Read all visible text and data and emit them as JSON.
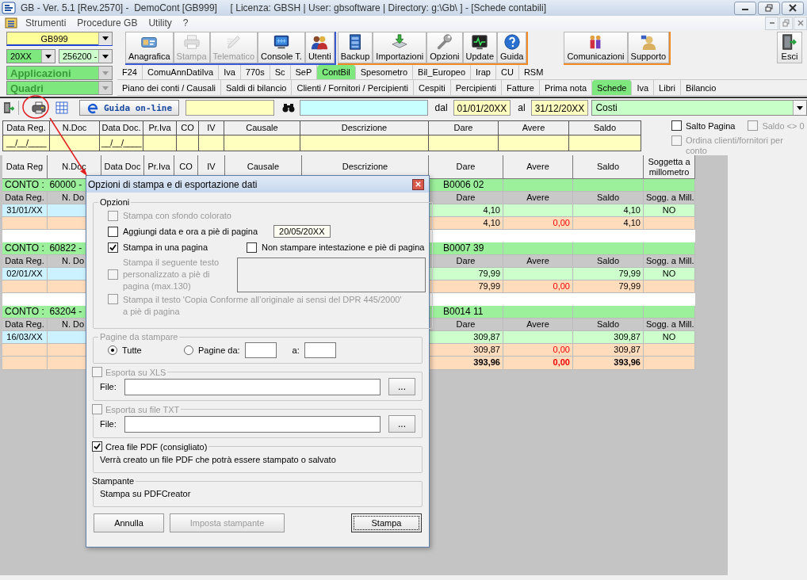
{
  "window": {
    "title": "GB - Ver. 5.1 [Rev.2570] -  DemoCont [GB999]     [ Licenza: GBSH | User: gbsoftware | Directory: g:\\Gb\\ ] - [Schede contabili]"
  },
  "menu": [
    "Strumenti",
    "Procedure GB",
    "Utility",
    "?"
  ],
  "selectors": {
    "company": "GB999",
    "year": "20XX",
    "account": "256200 -",
    "applications": "Applicazioni",
    "sections": "Quadri"
  },
  "toolbar_groups": [
    {
      "color": "#3a5bd0",
      "buttons": [
        {
          "label": "Anagrafica",
          "disabled": false
        },
        {
          "label": "Stampa",
          "disabled": true
        },
        {
          "label": "Telematico",
          "disabled": true
        },
        {
          "label": "Console T.",
          "disabled": false
        },
        {
          "label": "Utenti",
          "disabled": false
        }
      ]
    },
    {
      "color": "#f08a24",
      "buttons": [
        {
          "label": "Backup",
          "disabled": false
        },
        {
          "label": "Importazioni",
          "disabled": false
        },
        {
          "label": "Opzioni",
          "disabled": false
        },
        {
          "label": "Update",
          "disabled": false
        },
        {
          "label": "Guida",
          "disabled": false
        }
      ]
    },
    {
      "color": "#f08a24",
      "buttons": [
        {
          "label": "Comunicazioni",
          "disabled": false
        },
        {
          "label": "Supporto",
          "disabled": false
        }
      ]
    },
    {
      "buttons": [
        {
          "label": "Esci",
          "disabled": false
        }
      ]
    }
  ],
  "app_tabs": [
    {
      "label": "F24",
      "selected": false
    },
    {
      "label": "ComuAnnDatiIva",
      "selected": false
    },
    {
      "label": "Iva",
      "selected": false
    },
    {
      "label": "770s",
      "selected": false
    },
    {
      "label": "Sc",
      "selected": false
    },
    {
      "label": "SeP",
      "selected": false
    },
    {
      "label": "ContBil",
      "selected": true
    },
    {
      "label": "Spesometro",
      "selected": false
    },
    {
      "label": "Bil_Europeo",
      "selected": false
    },
    {
      "label": "Irap",
      "selected": false
    },
    {
      "label": "CU",
      "selected": false
    },
    {
      "label": "RSM",
      "selected": false
    }
  ],
  "section_tabs": [
    {
      "label": "Piano dei conti / Causali",
      "selected": false
    },
    {
      "label": "Saldi di bilancio",
      "selected": false
    },
    {
      "label": "Clienti / Fornitori / Percipienti",
      "selected": false
    },
    {
      "label": "Cespiti",
      "selected": false
    },
    {
      "label": "Percipienti",
      "selected": false
    },
    {
      "label": "Fatture",
      "selected": false
    },
    {
      "label": "Prima nota",
      "selected": false
    },
    {
      "label": "Schede",
      "selected": true
    },
    {
      "label": "Iva",
      "selected": false
    },
    {
      "label": "Libri",
      "selected": false
    },
    {
      "label": "Bilancio",
      "selected": false
    }
  ],
  "filter_bar": {
    "help_button": "Guida on-line",
    "date_from_label": "dal",
    "date_from": "01/01/20XX",
    "date_to_label": "al",
    "date_to": "31/12/20XX",
    "category": "Costi"
  },
  "filter_grid": [
    {
      "label": "Data Reg.",
      "mask": "__/__/____"
    },
    {
      "label": "N.Doc"
    },
    {
      "label": "Data Doc.",
      "mask": "__/__/____"
    },
    {
      "label": "Pr.Iva"
    },
    {
      "label": "CO"
    },
    {
      "label": "IV"
    },
    {
      "label": "Causale"
    },
    {
      "label": "Descrizione"
    },
    {
      "label": "Dare"
    },
    {
      "label": "Avere"
    },
    {
      "label": "Saldo"
    }
  ],
  "filter_options": [
    {
      "label": "Salto Pagina",
      "checked": false,
      "disabled": false
    },
    {
      "label": "Saldo <> 0",
      "checked": false,
      "disabled": true
    },
    {
      "label": "Ordina clienti/fornitori per conto",
      "checked": false,
      "disabled": true
    }
  ],
  "table": {
    "columns": [
      "Data Reg",
      "N.Doc",
      "Data Doc",
      "Pr.Iva",
      "CO",
      "IV",
      "Causale",
      "Descrizione",
      "Dare",
      "Avere",
      "Saldo",
      "Soggetta a millometro"
    ],
    "groups": [
      {
        "conto": "CONTO :  60000 -",
        "code": "B0006 02",
        "headers_left": [
          "Data Reg.",
          "N. Do"
        ],
        "headers_right": [
          "Dare",
          "Avere",
          "Saldo",
          "Sogg. a Mill."
        ],
        "entry": {
          "date": "31/01/XX",
          "dare": "4,10",
          "saldo": "4,10",
          "mill": "NO"
        },
        "total": {
          "dare": "4,10",
          "avere": "0,00",
          "saldo": "4,10"
        }
      },
      {
        "conto": "CONTO :  60822 -",
        "code": "B0007 39",
        "headers_left": [
          "Data Reg.",
          "N. Do"
        ],
        "headers_right": [
          "Dare",
          "Avere",
          "Saldo",
          "Sogg. a Mill."
        ],
        "entry": {
          "date": "02/01/XX",
          "dare": "79,99",
          "saldo": "79,99",
          "mill": "NO"
        },
        "total": {
          "dare": "79,99",
          "avere": "0,00",
          "saldo": "79,99"
        }
      },
      {
        "conto": "CONTO :  63204 -",
        "code": "B0014 11",
        "headers_left": [
          "Data Reg.",
          "N. Do"
        ],
        "headers_right": [
          "Dare",
          "Avere",
          "Saldo",
          "Sogg. a Mill."
        ],
        "entry": {
          "date": "16/03/XX",
          "dare": "309,87",
          "saldo": "309,87",
          "mill": "NO"
        },
        "total": {
          "dare": "309,87",
          "avere": "0,00",
          "saldo": "309,87"
        }
      }
    ],
    "grand_total": {
      "dare": "393,96",
      "avere": "0,00",
      "saldo": "393,96"
    }
  },
  "dialog": {
    "title": "Opzioni di stampa e di esportazione dati",
    "options_legend": "Opzioni",
    "options": [
      {
        "label": "Stampa con sfondo colorato",
        "checked": false,
        "disabled": true
      },
      {
        "label": "Aggiungi data e ora a piè di pagina",
        "checked": false,
        "disabled": false,
        "value": "20/05/20XX"
      },
      {
        "label": "Stampa in una pagina",
        "checked": true,
        "disabled": false
      },
      {
        "label": "Non stampare intestazione e piè di pagina",
        "checked": false,
        "disabled": false
      },
      {
        "label": "Stampa il seguente testo personalizzato a piè di pagina (max.130)",
        "checked": false,
        "disabled": true
      },
      {
        "label": "Stampa il testo 'Copia Conforme all’originale ai sensi del DPR 445/2000' a piè di pagina",
        "checked": false,
        "disabled": true
      }
    ],
    "pages": {
      "legend": "Pagine da stampare",
      "disabled": true,
      "choices": [
        {
          "label": "Tutte",
          "selected": true
        },
        {
          "label": "Pagine da:",
          "selected": false
        }
      ],
      "to_label": "a:"
    },
    "exports": [
      {
        "label": "Esporta su XLS",
        "checked": false,
        "disabled": true,
        "file_label": "File:",
        "browse": "..."
      },
      {
        "label": "Esporta su file TXT",
        "checked": false,
        "disabled": true,
        "file_label": "File:",
        "browse": "..."
      }
    ],
    "pdf": {
      "label": "Crea file PDF (consigliato)",
      "checked": true,
      "note": "Verrà creato un file PDF che potrà essere stampato o salvato"
    },
    "printer": {
      "legend": "Stampante",
      "name": "Stampa su PDFCreator"
    },
    "buttons": [
      {
        "label": "Annulla",
        "disabled": false,
        "default": false
      },
      {
        "label": "Imposta stampante",
        "disabled": true,
        "default": false
      },
      {
        "label": "Stampa",
        "disabled": false,
        "default": true
      }
    ]
  }
}
